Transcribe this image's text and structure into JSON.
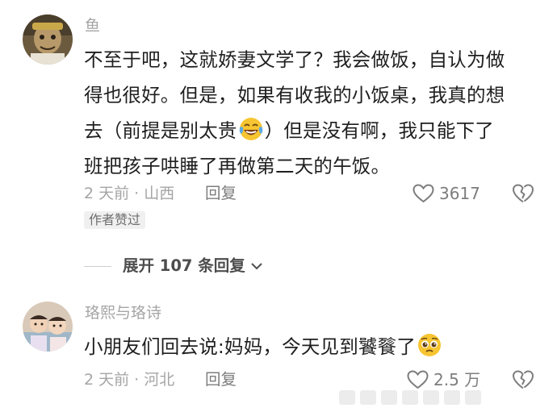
{
  "comments": [
    {
      "username": "鱼",
      "lines": [
        "不至于吧，这就娇妻文学了？我会做饭，自认为做",
        "得也很好。但是，如果有收我的小饭桌，我真的想"
      ],
      "line3_before": "去（前提是别太贵",
      "line3_emoji": "laughing-tears-emoji",
      "line3_after": "）但是没有啊，我只能下了",
      "line4": "班把孩子哄睡了再做第二天的午饭。",
      "time_location": "2 天前 · 山西",
      "reply_label": "回复",
      "like_count": "3617",
      "author_badge": "作者赞过",
      "expand_label": "展开 107 条回复"
    },
    {
      "username": "珞熙与珞诗",
      "text": "小朋友们回去说:妈妈，今天见到饕餮了",
      "emoji": "pleading-face-emoji",
      "time_location": "2 天前 · 河北",
      "reply_label": "回复",
      "like_count": "2.5 万"
    }
  ],
  "icons": {
    "like": "heart-outline-icon",
    "dislike": "broken-heart-icon",
    "expand": "chevron-down-icon"
  },
  "colors": {
    "meta_gray": "#a5a5a5",
    "text_dark": "#1f1f1f",
    "icon_gray": "#7d7d7d"
  }
}
